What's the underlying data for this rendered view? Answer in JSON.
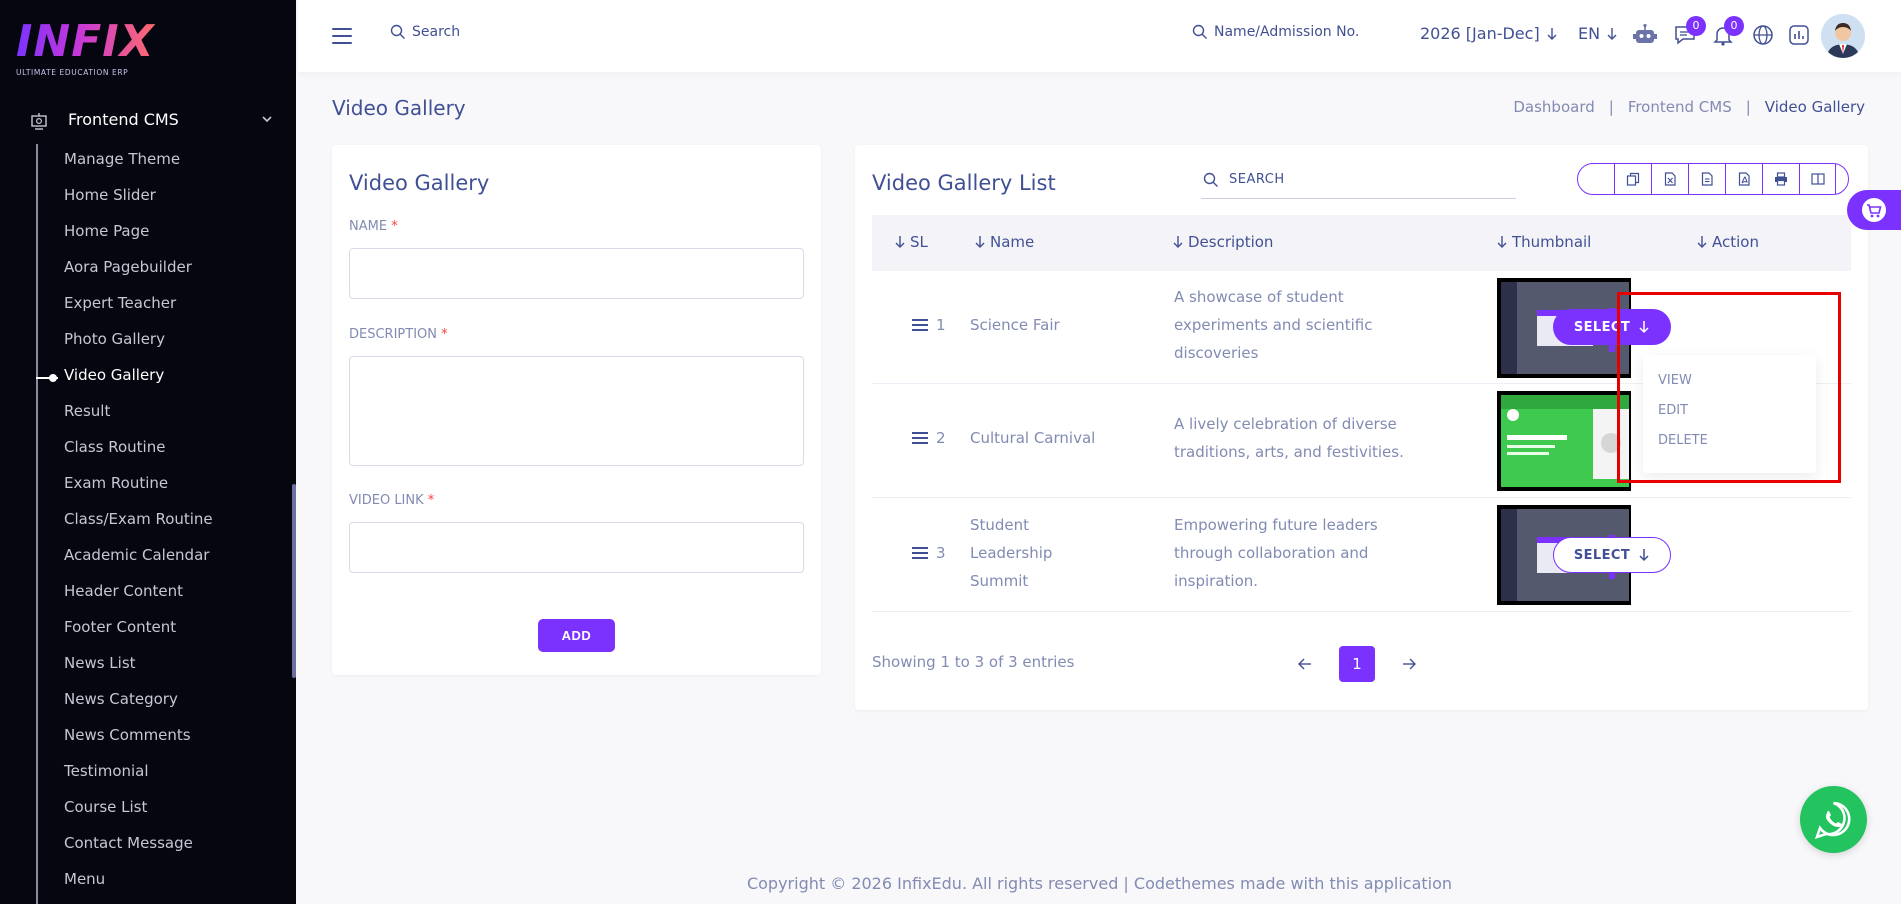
{
  "brand": {
    "logo_text": "INFIX",
    "tagline": "ULTIMATE EDUCATION ERP"
  },
  "sidebar": {
    "section_label": "Frontend CMS",
    "items": [
      {
        "label": "Manage Theme"
      },
      {
        "label": "Home Slider"
      },
      {
        "label": "Home Page"
      },
      {
        "label": "Aora Pagebuilder"
      },
      {
        "label": "Expert Teacher"
      },
      {
        "label": "Photo Gallery"
      },
      {
        "label": "Video Gallery",
        "active": true
      },
      {
        "label": "Result"
      },
      {
        "label": "Class Routine"
      },
      {
        "label": "Exam Routine"
      },
      {
        "label": "Class/Exam Routine"
      },
      {
        "label": "Academic Calendar"
      },
      {
        "label": "Header Content"
      },
      {
        "label": "Footer Content"
      },
      {
        "label": "News List"
      },
      {
        "label": "News Category"
      },
      {
        "label": "News Comments"
      },
      {
        "label": "Testimonial"
      },
      {
        "label": "Course List"
      },
      {
        "label": "Contact Message"
      },
      {
        "label": "Menu"
      }
    ]
  },
  "topbar": {
    "search_label": "Search",
    "student_search_label": "Name/Admission No.",
    "session": "2026 [Jan-Dec]",
    "language": "EN",
    "chat_badge": "0",
    "notification_badge": "0"
  },
  "page": {
    "title": "Video Gallery",
    "breadcrumb": [
      "Dashboard",
      "Frontend CMS",
      "Video Gallery"
    ]
  },
  "form": {
    "title": "Video Gallery",
    "name_label": "NAME",
    "description_label": "DESCRIPTION",
    "video_link_label": "VIDEO LINK",
    "required_mark": "*",
    "add_button": "ADD"
  },
  "list": {
    "title": "Video Gallery List",
    "search_label": "SEARCH",
    "columns": [
      "SL",
      "Name",
      "Description",
      "Thumbnail",
      "Action"
    ],
    "rows": [
      {
        "sl": "1",
        "name": "Science Fair",
        "description": "A showcase of student experiments and scientific discoveries"
      },
      {
        "sl": "2",
        "name": "Cultural Carnival",
        "description": "A lively celebration of diverse traditions, arts, and festivities."
      },
      {
        "sl": "3",
        "name": "Student Leadership Summit",
        "description": "Empowering future leaders through collaboration and inspiration."
      }
    ],
    "select_label": "SELECT",
    "dropdown": [
      "VIEW",
      "EDIT",
      "DELETE"
    ],
    "showing": "Showing 1 to 3 of 3 entries",
    "current_page": "1"
  },
  "footer": {
    "text": "Copyright © 2026 InfixEdu. All rights reserved | Codethemes made with this application"
  },
  "colors": {
    "primary": "#7c32ff",
    "text": "#415094",
    "muted": "#828bb2",
    "sidebar_bg": "#05060f",
    "highlight": "#e60000",
    "whatsapp": "#23c35f"
  }
}
